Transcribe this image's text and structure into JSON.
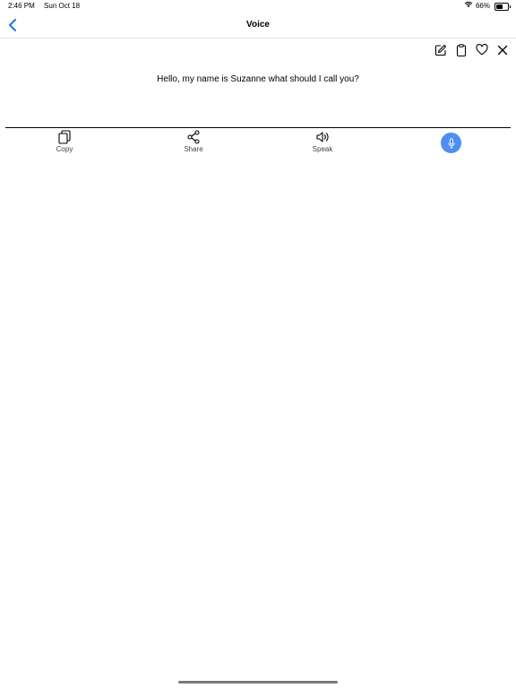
{
  "status_bar": {
    "time": "2:46 PM",
    "date": "Sun Oct 18",
    "battery": "66%",
    "battery_level": 0.66
  },
  "nav": {
    "title": "Voice",
    "back_icon": "chevron-left-icon",
    "accent_color": "#1a73e8"
  },
  "editor": {
    "toolbar": [
      "edit-icon",
      "clipboard-icon",
      "heart-icon",
      "close-icon"
    ],
    "text": "Hello, my name is Suzanne what should I call you?"
  },
  "actions": {
    "copy_label": "Copy",
    "share_label": "Share",
    "speak_label": "Speak",
    "mic_color": "#4d8ef0"
  }
}
